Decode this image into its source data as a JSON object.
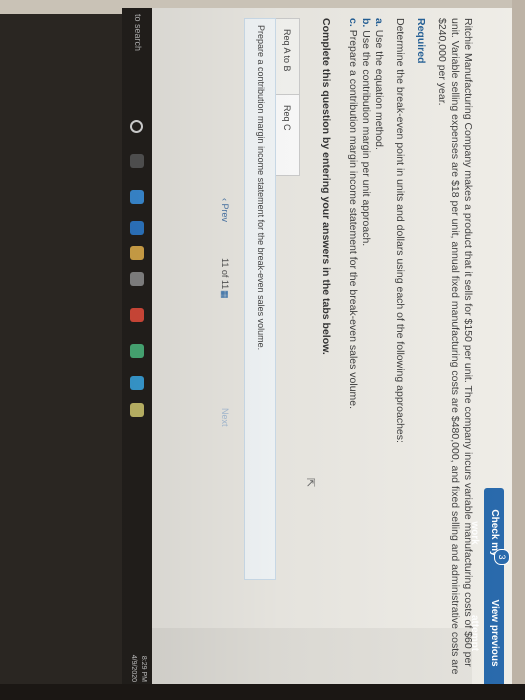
{
  "toolbar": {
    "check_label": "Check my work",
    "check_badge": "3",
    "view_previous_label": "View previous attempt"
  },
  "problem": {
    "paragraph": "Ritchie Manufacturing Company makes a product that it sells for $150 per unit. The company incurs variable manufacturing costs of $60 per unit. Variable selling expenses are $18 per unit, annual fixed manufacturing costs are $480,000, and fixed selling and administrative costs are $240,000 per year.",
    "required_title": "Required",
    "required_line": "Determine the break-even point in units and dollars using each of the following approaches:",
    "items": [
      {
        "letter": "a.",
        "text": "Use the equation method."
      },
      {
        "letter": "b.",
        "text": "Use the contribution margin per unit approach."
      },
      {
        "letter": "c.",
        "text": "Prepare a contribution margin income statement for the break-even sales volume."
      }
    ]
  },
  "complete_prompt": "Complete this question by entering your answers in the tabs below.",
  "tabs": [
    {
      "label": "Req A to B"
    },
    {
      "label": "Req C"
    }
  ],
  "instruction": "Prepare a contribution margin income statement for the break-even sales volume.",
  "pager": {
    "prev_label": "Prev",
    "count_text": "11 of 11",
    "next_label": "Next"
  },
  "taskbar": {
    "search_text": "to search",
    "time": "8:29 PM",
    "date": "4/9/2020"
  }
}
